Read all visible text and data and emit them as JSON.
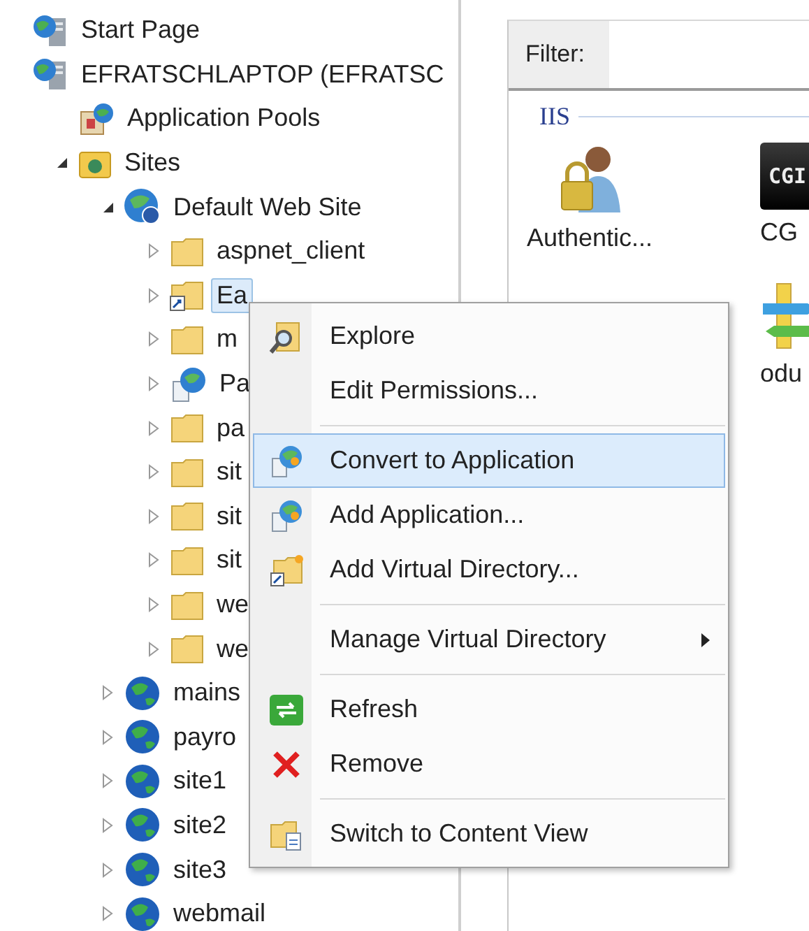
{
  "tree": [
    {
      "label": "Start Page",
      "kind": "server",
      "selected": false
    },
    {
      "label": "EFRATSCHLAPTOP (EFRATSC",
      "kind": "server",
      "selected": false,
      "children": [
        {
          "label": "Application Pools",
          "kind": "pool",
          "selected": false
        },
        {
          "label": "Sites",
          "kind": "sites",
          "selected": false,
          "expanded": true,
          "children": [
            {
              "label": "Default Web Site",
              "kind": "site",
              "selected": false,
              "expanded": true,
              "children": [
                {
                  "label": "aspnet_client",
                  "kind": "folder",
                  "selected": false,
                  "expanded": false
                },
                {
                  "label": "Ea",
                  "kind": "vdir",
                  "selected": true,
                  "expanded": false
                },
                {
                  "label": "m",
                  "kind": "folder",
                  "selected": false,
                  "expanded": false
                },
                {
                  "label": "Pa",
                  "kind": "app",
                  "selected": false,
                  "expanded": false
                },
                {
                  "label": "pa",
                  "kind": "folder",
                  "selected": false,
                  "expanded": false
                },
                {
                  "label": "sit",
                  "kind": "folder",
                  "selected": false,
                  "expanded": false
                },
                {
                  "label": "sit",
                  "kind": "folder",
                  "selected": false,
                  "expanded": false
                },
                {
                  "label": "sit",
                  "kind": "folder",
                  "selected": false,
                  "expanded": false
                },
                {
                  "label": "we",
                  "kind": "folder",
                  "selected": false,
                  "expanded": false
                },
                {
                  "label": "we",
                  "kind": "folder",
                  "selected": false,
                  "expanded": false
                }
              ]
            },
            {
              "label": "mains",
              "kind": "globe",
              "selected": false,
              "expanded": false
            },
            {
              "label": "payro",
              "kind": "globe",
              "selected": false,
              "expanded": false
            },
            {
              "label": "site1",
              "kind": "globe",
              "selected": false,
              "expanded": false
            },
            {
              "label": "site2",
              "kind": "globe",
              "selected": false,
              "expanded": false
            },
            {
              "label": "site3",
              "kind": "globe",
              "selected": false,
              "expanded": false
            },
            {
              "label": "webmail",
              "kind": "globe",
              "selected": false,
              "expanded": false
            }
          ]
        }
      ]
    }
  ],
  "filter": {
    "label": "Filter:"
  },
  "group": {
    "title": "IIS"
  },
  "features": [
    {
      "label": "Authentic...",
      "kind": "auth"
    },
    {
      "label": "CG",
      "kind": "cgi",
      "badge": "CGI"
    },
    {
      "label": "odu",
      "kind": "modules"
    }
  ],
  "context_menu": [
    {
      "kind": "item",
      "label": "Explore",
      "selected": false,
      "submenu": false
    },
    {
      "kind": "item",
      "label": "Edit Permissions...",
      "selected": false,
      "submenu": false
    },
    {
      "kind": "separator"
    },
    {
      "kind": "item",
      "label": "Convert to Application",
      "selected": true,
      "submenu": false
    },
    {
      "kind": "item",
      "label": "Add Application...",
      "selected": false,
      "submenu": false
    },
    {
      "kind": "item",
      "label": "Add Virtual Directory...",
      "selected": false,
      "submenu": false
    },
    {
      "kind": "separator"
    },
    {
      "kind": "item",
      "label": "Manage Virtual Directory",
      "selected": false,
      "submenu": true
    },
    {
      "kind": "separator"
    },
    {
      "kind": "item",
      "label": "Refresh",
      "selected": false,
      "submenu": false
    },
    {
      "kind": "item",
      "label": "Remove",
      "selected": false,
      "submenu": false
    },
    {
      "kind": "separator"
    },
    {
      "kind": "item",
      "label": "Switch to Content View",
      "selected": false,
      "submenu": false
    }
  ]
}
